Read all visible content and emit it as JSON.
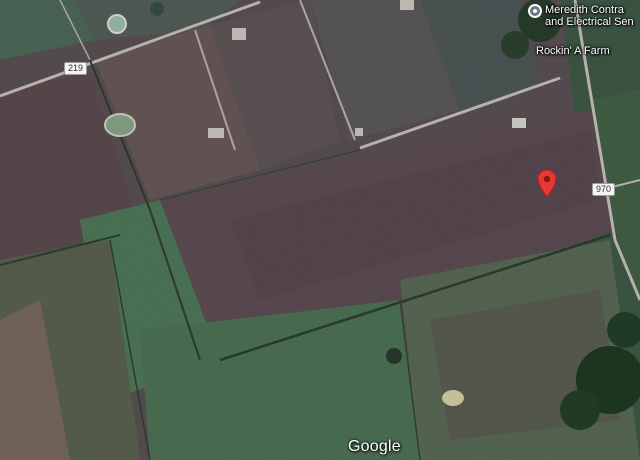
{
  "map": {
    "roads": [
      {
        "id": "219",
        "label": "219"
      },
      {
        "id": "970",
        "label": "970"
      }
    ],
    "places": [
      {
        "name_line1": "Meredith Contra",
        "name_line2": "and Electrical Sen",
        "icon": "place-dot-icon"
      },
      {
        "name_line1": "Rockin' A Farm",
        "icon": "place-dot-icon"
      }
    ],
    "pin": {
      "icon": "map-pin-icon",
      "color": "#e53935"
    },
    "attribution": "Google",
    "colors": {
      "field": "#5f5457",
      "grass": "#4f7a55",
      "road": "#c9c2bd"
    }
  }
}
